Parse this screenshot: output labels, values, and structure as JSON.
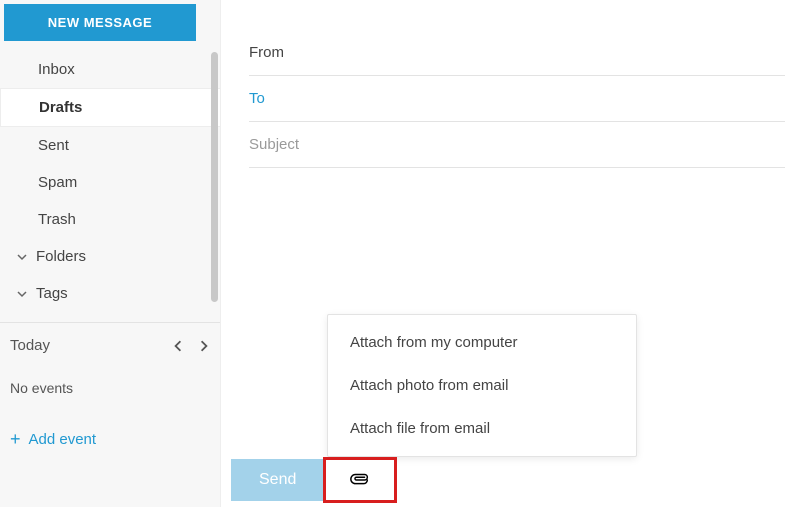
{
  "sidebar": {
    "newMessage": "NEW MESSAGE",
    "items": [
      {
        "label": "Inbox"
      },
      {
        "label": "Drafts",
        "active": true
      },
      {
        "label": "Sent"
      },
      {
        "label": "Spam"
      },
      {
        "label": "Trash"
      }
    ],
    "sections": [
      {
        "label": "Folders"
      },
      {
        "label": "Tags"
      }
    ]
  },
  "agenda": {
    "title": "Today",
    "empty": "No events",
    "addEvent": "Add event"
  },
  "compose": {
    "fromLabel": "From",
    "toLabel": "To",
    "subjectPlaceholder": "Subject",
    "sendLabel": "Send"
  },
  "attachMenu": {
    "items": [
      {
        "label": "Attach from my computer"
      },
      {
        "label": "Attach photo from email"
      },
      {
        "label": "Attach file from email"
      }
    ]
  }
}
